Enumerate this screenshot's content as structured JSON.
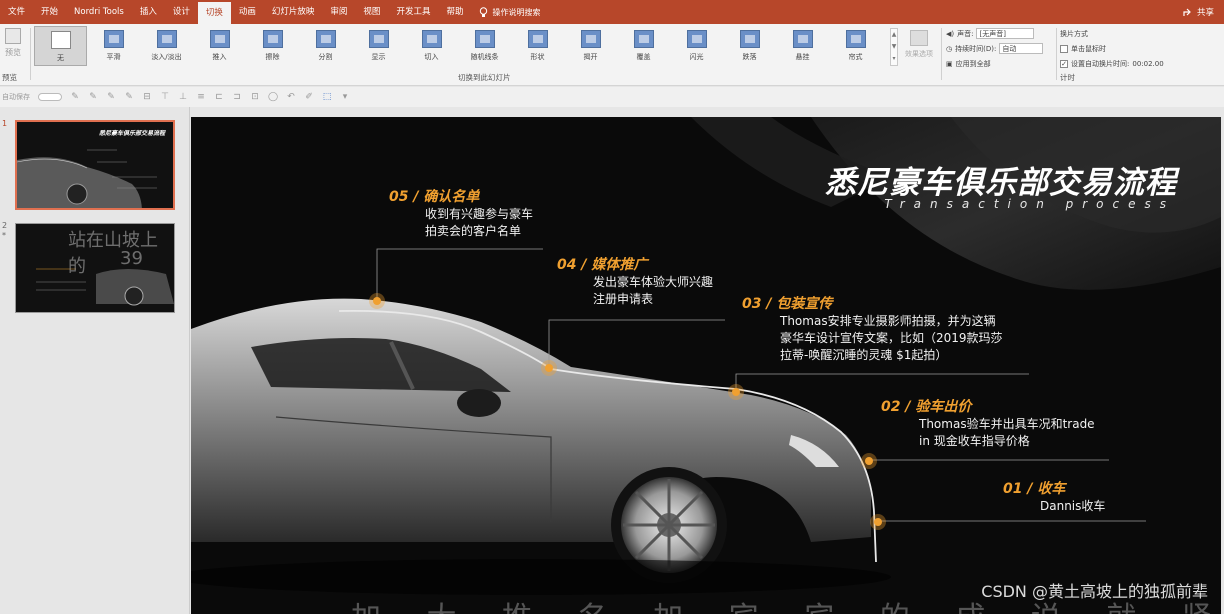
{
  "menubar": {
    "tabs": [
      "文件",
      "开始",
      "Nordri Tools",
      "插入",
      "设计",
      "切换",
      "动画",
      "幻灯片放映",
      "审阅",
      "视图",
      "开发工具",
      "帮助"
    ],
    "active_tab": "切换",
    "tell_me": "操作说明搜索",
    "share": "共享"
  },
  "ribbon": {
    "preview_label": "预览",
    "preview_group": "预览",
    "transitions": [
      "无",
      "平滑",
      "淡入/淡出",
      "推入",
      "擦除",
      "分割",
      "显示",
      "切入",
      "随机线条",
      "形状",
      "揭开",
      "覆盖",
      "闪光",
      "跌落",
      "悬挂",
      "帘式"
    ],
    "selected_transition": "无",
    "transitions_group": "切换到此幻灯片",
    "effect_options": "效果选项",
    "sound_label": "声音:",
    "sound_value": "[无声音]",
    "duration_label": "持续时间(D):",
    "duration_value": "自动",
    "apply_all": "应用到全部",
    "advance_title": "换片方式",
    "on_click": "单击鼠标时",
    "after_time": "设置自动换片时间:",
    "after_time_value": "00:02.00",
    "timing_group": "计时"
  },
  "qat": {
    "autosave": "自动保存"
  },
  "thumbnails": {
    "slide1_number": "1",
    "slide2_number": "2",
    "slide2_marker": "*",
    "slide1_title": "悉尼豪车俱乐部交易流程",
    "slide2_overlay_line1": "站在山坡上的",
    "slide2_overlay_line2": "39"
  },
  "slide": {
    "title": "悉尼豪车俱乐部交易流程",
    "subtitle": "Transaction process",
    "steps": [
      {
        "title": "05 / 确认名单",
        "desc": "收到有兴趣参与豪车\n拍卖会的客户名单"
      },
      {
        "title": "04 / 媒体推广",
        "desc": "发出豪车体验大师兴趣\n注册申请表"
      },
      {
        "title": "03 / 包装宣传",
        "desc": "Thomas安排专业摄影师拍摄，并为这辆\n豪华车设计宣传文案，比如（2019款玛莎\n拉蒂-唤醒沉睡的灵魂 $1起拍）"
      },
      {
        "title": "02 / 验车出价",
        "desc": "Thomas验车并出具车况和trade\nin 现金收车指导价格"
      },
      {
        "title": "01 / 收车",
        "desc": "Dannis收车"
      }
    ],
    "bottom_text": "加 大 推 名 加 宾 宾 的 成 说 就 紧 打"
  },
  "watermark": "CSDN @黄土高坡上的独孤前辈",
  "colors": {
    "brand": "#b7472a",
    "accent_gold": "#f0a030",
    "slide_bg": "#0a0a0a"
  }
}
